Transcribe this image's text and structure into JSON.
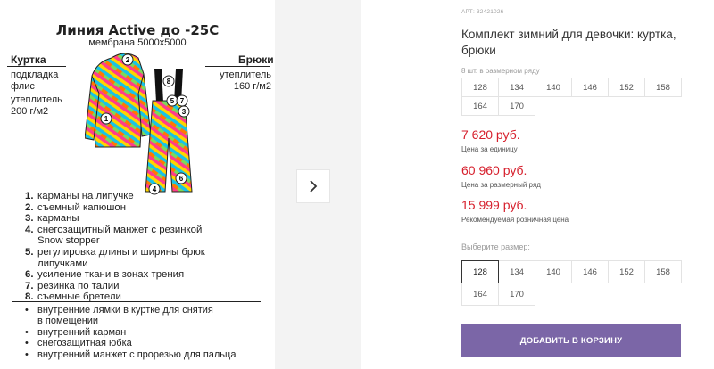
{
  "product_card": {
    "title": "Линия Active до -25С",
    "subtitle": "мембрана 5000х5000",
    "jacket": {
      "heading": "Куртка",
      "lining": "подкладка флис",
      "insulation": "утеплитель 200 г/м2"
    },
    "pants": {
      "heading": "Брюки",
      "insulation": "утеплитель 160 г/м2"
    },
    "callout_numbers": [
      "1",
      "2",
      "3",
      "4",
      "5",
      "6",
      "7",
      "8"
    ],
    "features": [
      {
        "num": "1.",
        "text": "карманы на липучке"
      },
      {
        "num": "2.",
        "text": "съемный капюшон"
      },
      {
        "num": "3.",
        "text": "карманы"
      },
      {
        "num": "4.",
        "text": "снегозащитный манжет с резинкой Snow stopper"
      },
      {
        "num": "5.",
        "text": "регулировка длины и ширины брюк липучками"
      },
      {
        "num": "6.",
        "text": "усиление ткани в зонах трения"
      },
      {
        "num": "7.",
        "text": "резинка по талии"
      },
      {
        "num": "8.",
        "text": "съемные бретели"
      }
    ],
    "extras": [
      "внутренние лямки в куртке для снятия в помещении",
      "внутренний карман",
      "снегозащитная юбка",
      "внутренний манжет с прорезью для пальца"
    ]
  },
  "gallery": {
    "next_icon": "chevron-right-icon"
  },
  "product": {
    "article": "АРТ: 32421026",
    "title": "Комплект зимний для девочки: куртка, брюки",
    "pack_label": "8 шт. в размерном ряду",
    "pack_sizes": [
      "128",
      "134",
      "140",
      "146",
      "152",
      "158",
      "164",
      "170"
    ],
    "price_unit": "7 620 руб.",
    "price_unit_label": "Цена за единицу",
    "price_pack": "60 960 руб.",
    "price_pack_label": "Цена за размерный ряд",
    "price_retail": "15 999 руб.",
    "price_retail_label": "Рекомендуемая розничная цена",
    "select_label": "Выберите размер:",
    "select_sizes": [
      "128",
      "134",
      "140",
      "146",
      "152",
      "158",
      "164",
      "170"
    ],
    "selected_size": "128",
    "add_to_cart": "ДОБАВИТЬ В КОРЗИНУ"
  },
  "colors": {
    "price": "#d61f2c",
    "button": "#7b66a7",
    "gallery_bg": "#f3f3f3"
  }
}
